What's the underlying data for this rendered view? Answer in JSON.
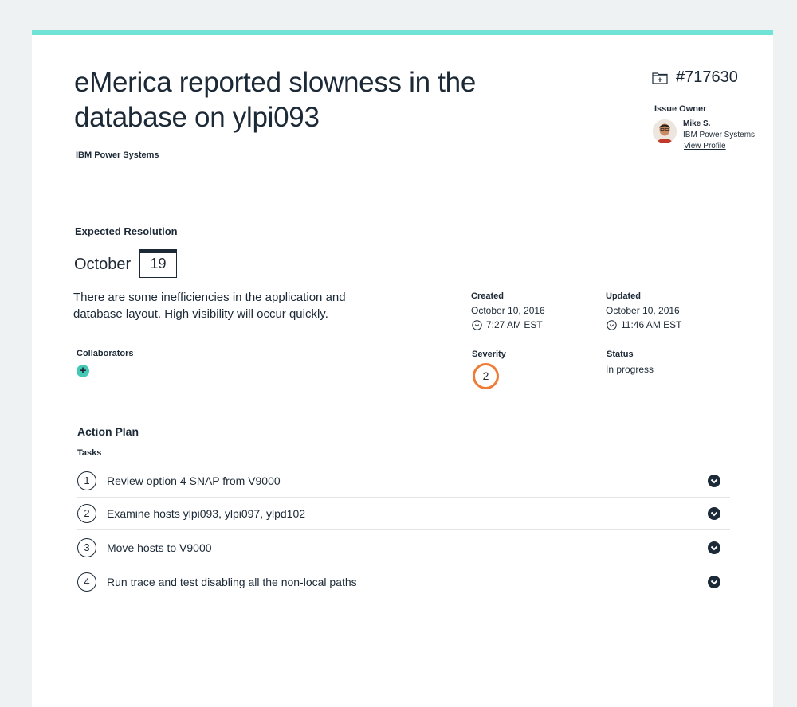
{
  "issue": {
    "title": "eMerica reported slowness in the database on ylpi093",
    "product": "IBM Power Systems",
    "ticket_number": "#717630"
  },
  "owner": {
    "label": "Issue Owner",
    "name": "Mike S.",
    "org": "IBM Power Systems",
    "link": "View Profile"
  },
  "resolution": {
    "label": "Expected Resolution",
    "month": "October",
    "day": "19",
    "description": "There are some inefficiencies in the application and database layout. High visibility will occur quickly."
  },
  "meta": {
    "created_label": "Created",
    "created_date": "October 10, 2016",
    "created_time": "7:27 AM EST",
    "updated_label": "Updated",
    "updated_date": "October 10, 2016",
    "updated_time": "11:46 AM EST",
    "severity_label": "Severity",
    "severity_value": "2",
    "status_label": "Status",
    "status_value": "In progress"
  },
  "collaborators": {
    "label": "Collaborators",
    "add_symbol": "+"
  },
  "action_plan": {
    "title": "Action Plan",
    "tasks_label": "Tasks",
    "tasks": [
      {
        "num": "1",
        "text": "Review option 4 SNAP from V9000"
      },
      {
        "num": "2",
        "text": "Examine hosts ylpi093, ylpi097, ylpd102"
      },
      {
        "num": "3",
        "text": "Move hosts to V9000"
      },
      {
        "num": "4",
        "text": "Run trace and test disabling all the non-local paths"
      }
    ]
  },
  "colors": {
    "accent": "#6fe3d5",
    "add_button": "#45c9b7",
    "severity": "#f07b35",
    "text": "#1c2936"
  },
  "icons": {
    "ticket": "folder-plus-icon",
    "clock": "clock-icon",
    "expand": "chevron-down-icon"
  }
}
